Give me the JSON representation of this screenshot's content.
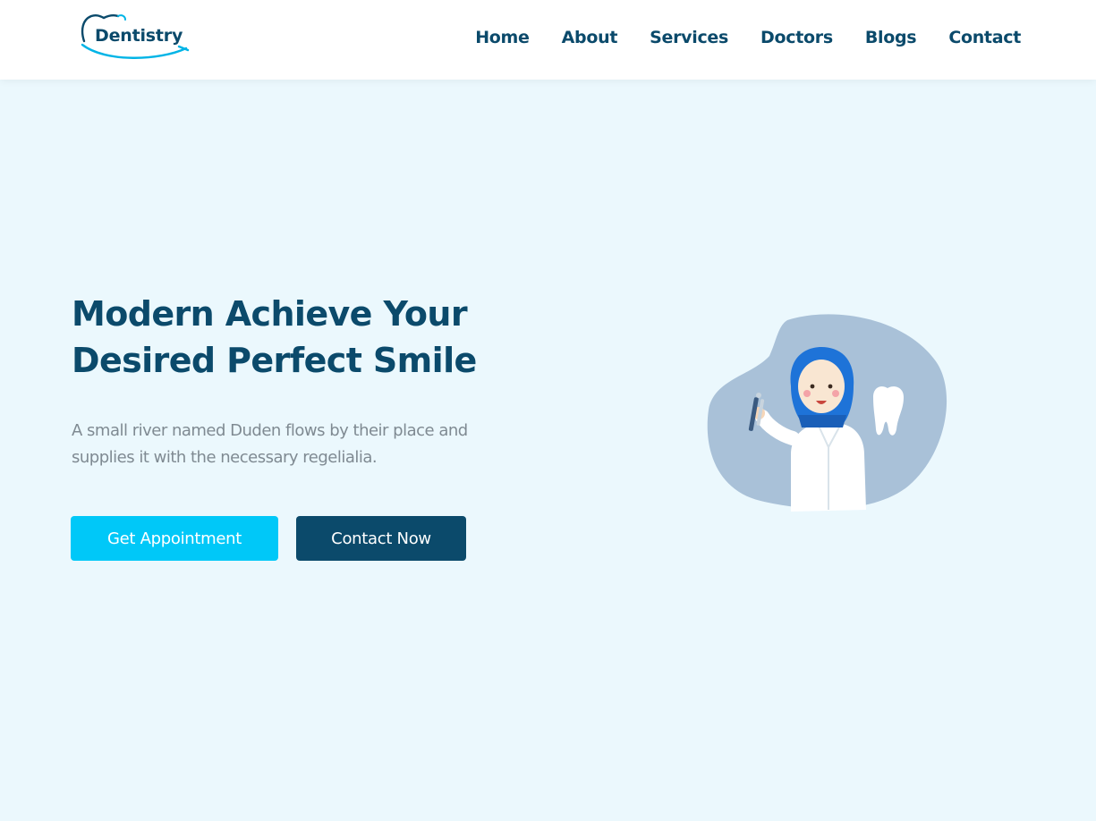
{
  "brand": {
    "name": "Dentistry",
    "primary_color": "#0b4a6b",
    "accent_color": "#00c8f8",
    "background_color": "#ebf8fd"
  },
  "nav": {
    "items": [
      {
        "label": "Home"
      },
      {
        "label": "About"
      },
      {
        "label": "Services"
      },
      {
        "label": "Doctors"
      },
      {
        "label": "Blogs"
      },
      {
        "label": "Contact"
      }
    ]
  },
  "hero": {
    "title_line1": "Modern Achieve Your",
    "title_line2": "Desired Perfect Smile",
    "text_line1": "A small river named Duden flows by their place and",
    "text_line2": "supplies it with the necessary regelialia.",
    "primary_button": "Get Appointment",
    "secondary_button": "Contact Now",
    "illustration_icon": "dentist-with-tooth-illustration"
  }
}
